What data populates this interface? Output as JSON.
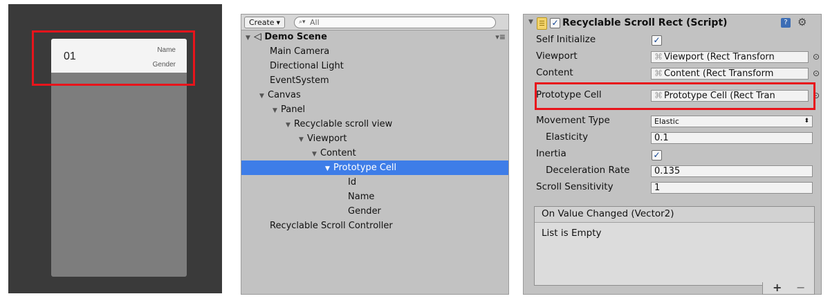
{
  "game_view": {
    "cell": {
      "id": "01",
      "name": "Name",
      "gender": "Gender"
    }
  },
  "hierarchy": {
    "create_label": "Create",
    "search_placeholder": "All",
    "scene": "Demo Scene",
    "items": [
      {
        "label": "Main Camera"
      },
      {
        "label": "Directional Light"
      },
      {
        "label": "EventSystem"
      },
      {
        "label": "Canvas"
      },
      {
        "label": "Panel"
      },
      {
        "label": "Recyclable scroll view"
      },
      {
        "label": "Viewport"
      },
      {
        "label": "Content"
      },
      {
        "label": "Prototype Cell"
      },
      {
        "label": "Id"
      },
      {
        "label": "Name"
      },
      {
        "label": "Gender"
      },
      {
        "label": "Recyclable Scroll Controller"
      }
    ],
    "selected_item": "Prototype Cell"
  },
  "inspector": {
    "component_title": "Recyclable Scroll Rect (Script)",
    "component_enabled": true,
    "fields": {
      "self_initialize": {
        "label": "Self Initialize",
        "checked": true
      },
      "viewport": {
        "label": "Viewport",
        "value": "Viewport (Rect Transforn"
      },
      "content": {
        "label": "Content",
        "value": "Content (Rect Transform"
      },
      "prototype_cell": {
        "label": "Prototype Cell",
        "value": "Prototype Cell (Rect Tran"
      },
      "movement_type": {
        "label": "Movement Type",
        "value": "Elastic"
      },
      "elasticity": {
        "label": "Elasticity",
        "value": "0.1"
      },
      "inertia": {
        "label": "Inertia",
        "checked": true
      },
      "deceleration_rate": {
        "label": "Deceleration Rate",
        "value": "0.135"
      },
      "scroll_sensitivity": {
        "label": "Scroll Sensitivity",
        "value": "1"
      }
    },
    "event": {
      "title": "On Value Changed (Vector2)",
      "empty_text": "List is Empty",
      "add": "+",
      "remove": "−"
    }
  },
  "colors": {
    "highlight": "#e8141b",
    "selection": "#3e7de8",
    "panel_bg": "#c2c2c2",
    "game_bg": "#3a3a3a"
  }
}
